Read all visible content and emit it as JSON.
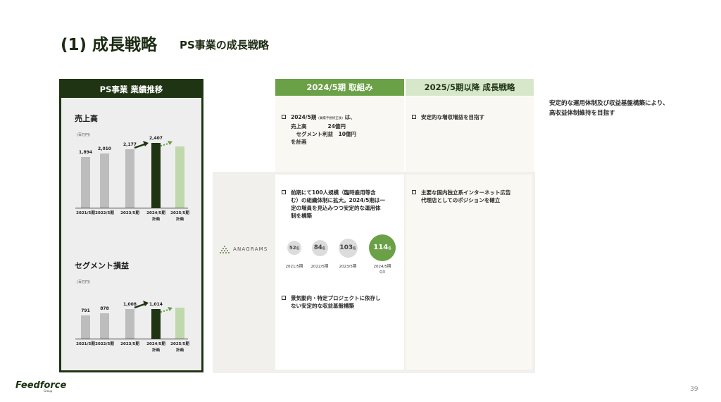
{
  "title": "(1) 成長戦略",
  "subtitle": "PS事業の成長戦略",
  "left_panel": {
    "header": "PS事業 業績推移",
    "sales": {
      "title": "売上高",
      "unit": "(百万円)",
      "values": [
        "1,894",
        "2,010",
        "2,177",
        "2,407",
        ""
      ],
      "amounts": [
        1894,
        2010,
        2177,
        2407,
        2280
      ]
    },
    "segment": {
      "title": "セグメント損益",
      "unit": "(百万円)",
      "values": [
        "791",
        "878",
        "1,008",
        "1,014",
        ""
      ],
      "amounts": [
        791,
        878,
        1008,
        1014,
        1060
      ]
    },
    "categories": [
      "2021/5期",
      "2022/5期",
      "2023/5期",
      "2024/5期\n計画",
      "2025/5期\n計画"
    ],
    "colors": {
      "past": "#bdbdbd",
      "current": "#1e3412",
      "future": "#bfd9ad",
      "accent": "#6aa046"
    }
  },
  "columns": {
    "current_header": "2024/5期 取組み",
    "future_header": "2025/5期以降 成長戦略",
    "current_color": "#6aa046",
    "future_color": "#bfd9ad"
  },
  "current": {
    "bullet1_line1": "2024/5期",
    "bullet1_small": "(業績予想修正後)",
    "bullet1_line1_end": "は、",
    "bullet1_rest": "売上高　　　　24億円\n 　セグメント利益　10億円\nを計画",
    "bullet2": "前期にて100人規模（臨時雇用等含\nむ）の組織体制に拡大。2024/5期は一\n定の増員を見込みつつ安定的な運用体\n制を構築",
    "bullet3": "景気動向・特定プロジェクトに依存し\nない安定的な収益基盤構築"
  },
  "future": {
    "bullet1": "安定的な増収増益を目指す",
    "bullet2": "主要な国内独立系インターネット広告\n代理店としてのポジションを確立"
  },
  "headcount": {
    "values": [
      "52",
      "84",
      "103",
      "114"
    ],
    "unit": "名",
    "labels": [
      "2021/5期",
      "2022/5期",
      "2023/5期",
      "2024/5期\nQ3"
    ]
  },
  "brand": "ANAGRAMS",
  "right_note": "安定的な運用体制及び収益基盤構築により、高収益体制維持を目指す",
  "footer": {
    "logo": "Feedforce",
    "logo_sub": "Group",
    "page": "39"
  }
}
